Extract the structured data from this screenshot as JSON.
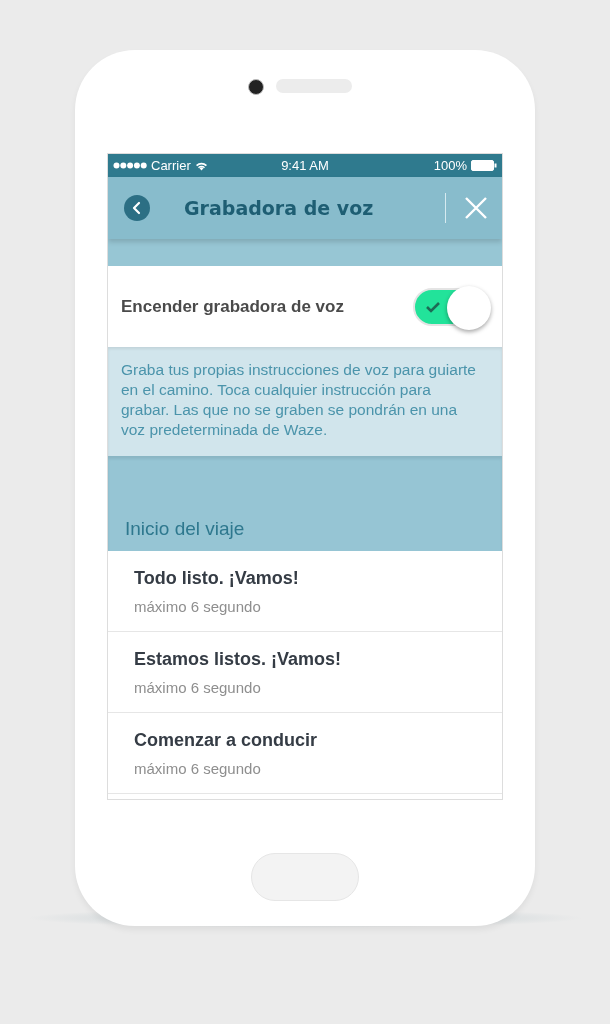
{
  "status_bar": {
    "carrier": "Carrier",
    "time": "9:41 AM",
    "battery": "100%"
  },
  "header": {
    "title": "Grabadora de voz"
  },
  "toggle": {
    "label": "Encender grabadora de voz",
    "on": true
  },
  "info": "Graba tus propias instrucciones de voz para guiarte en el camino. Toca cualquier instrucción para grabar. Las que no se graben se pondrán en una voz predeterminada de Waze.",
  "section": {
    "title": "Inicio del viaje"
  },
  "items": [
    {
      "title": "Todo listo. ¡Vamos!",
      "subtitle": "máximo 6 segundo"
    },
    {
      "title": "Estamos listos. ¡Vamos!",
      "subtitle": "máximo 6 segundo"
    },
    {
      "title": "Comenzar a conducir",
      "subtitle": "máximo 6 segundo"
    }
  ]
}
